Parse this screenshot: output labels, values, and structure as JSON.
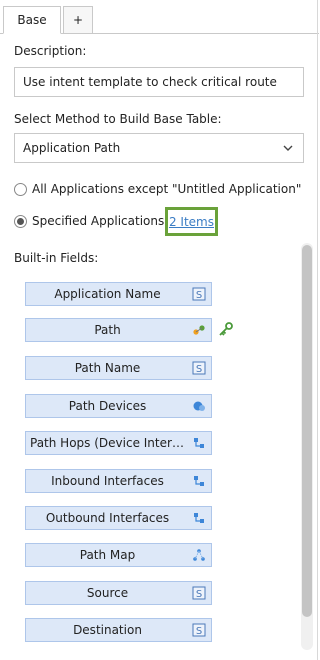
{
  "tabs": [
    {
      "label": "Base",
      "active": true
    },
    {
      "label": "+",
      "active": false
    }
  ],
  "description": {
    "label": "Description:",
    "value": "Use intent template to check critical route"
  },
  "method": {
    "label": "Select Method to Build Base Table:",
    "selected": "Application Path"
  },
  "applications": {
    "option_all": "All Applications except \"Untitled Application\"",
    "option_specified": "Specified Applications",
    "selected": "specified",
    "items_link": "2 Items"
  },
  "builtin": {
    "label": "Built-in Fields:",
    "fields": [
      {
        "label": "Application Name",
        "icon": "string-icon"
      },
      {
        "label": "Path",
        "icon": "path-icon",
        "key": true
      },
      {
        "label": "Path Name",
        "icon": "string-icon"
      },
      {
        "label": "Path Devices",
        "icon": "devices-icon"
      },
      {
        "label": "Path Hops (Device Interfa...",
        "icon": "interfaces-icon"
      },
      {
        "label": "Inbound Interfaces",
        "icon": "interfaces-icon"
      },
      {
        "label": "Outbound Interfaces",
        "icon": "interfaces-icon"
      },
      {
        "label": "Path Map",
        "icon": "map-icon"
      },
      {
        "label": "Source",
        "icon": "string-icon"
      },
      {
        "label": "Destination",
        "icon": "string-icon"
      }
    ]
  },
  "colors": {
    "accent_border": "#6aa23a",
    "link": "#3b7dc4",
    "field_bg": "#dde8f8",
    "field_border": "#aec6ea"
  }
}
